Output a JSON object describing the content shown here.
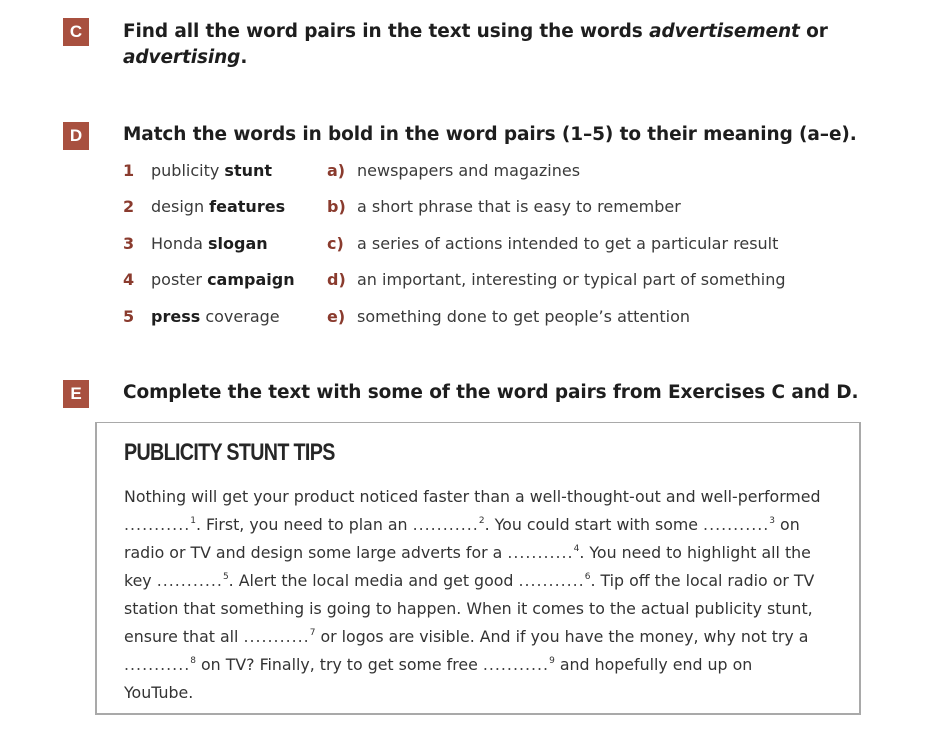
{
  "exercises": {
    "C": {
      "letter": "C",
      "instruction_part1": "Find all the word pairs in the text using the words ",
      "instruction_em1": "advertisement",
      "instruction_part2": " or",
      "instruction_em2": "advertising",
      "instruction_part3": "."
    },
    "D": {
      "letter": "D",
      "instruction": "Match the words in bold in the word pairs (1–5) to their meaning (a–e).",
      "pairs": [
        {
          "num": "1",
          "plain_before": "publicity ",
          "bold": "stunt",
          "plain_after": "",
          "letter": "a)",
          "meaning": "newspapers and magazines"
        },
        {
          "num": "2",
          "plain_before": "design ",
          "bold": "features",
          "plain_after": "",
          "letter": "b)",
          "meaning": "a short phrase that is easy to remember"
        },
        {
          "num": "3",
          "plain_before": "Honda ",
          "bold": "slogan",
          "plain_after": "",
          "letter": "c)",
          "meaning": "a series of actions intended to get a particular result"
        },
        {
          "num": "4",
          "plain_before": "poster ",
          "bold": "campaign",
          "plain_after": "",
          "letter": "d)",
          "meaning": "an important, interesting or typical part of something"
        },
        {
          "num": "5",
          "plain_before": "",
          "bold": "press",
          "plain_after": " coverage",
          "letter": "e)",
          "meaning": "something done to get people’s attention"
        }
      ]
    },
    "E": {
      "letter": "E",
      "instruction": "Complete the text with some of the word pairs from Exercises C and D.",
      "box_title": "PUBLICITY STUNT TIPS",
      "gap": "...........",
      "segments": [
        "Nothing will get your product noticed faster than a well-thought-out and well-performed ",
        ". First, you need to plan an ",
        ". You could start with some ",
        " on radio or TV and design some large adverts for a ",
        ". You need to highlight all the key ",
        ". Alert the local media and get good ",
        ". Tip off the local radio or TV station that something is going to happen. When it comes to the actual publicity stunt, ensure that all ",
        " or logos are visible. And if you have the money, why not try a ",
        " on TV? Finally, try to get some free ",
        " and hopefully end up on YouTube."
      ],
      "gap_numbers": [
        "1",
        "2",
        "3",
        "4",
        "5",
        "6",
        "7",
        "8",
        "9"
      ]
    }
  }
}
